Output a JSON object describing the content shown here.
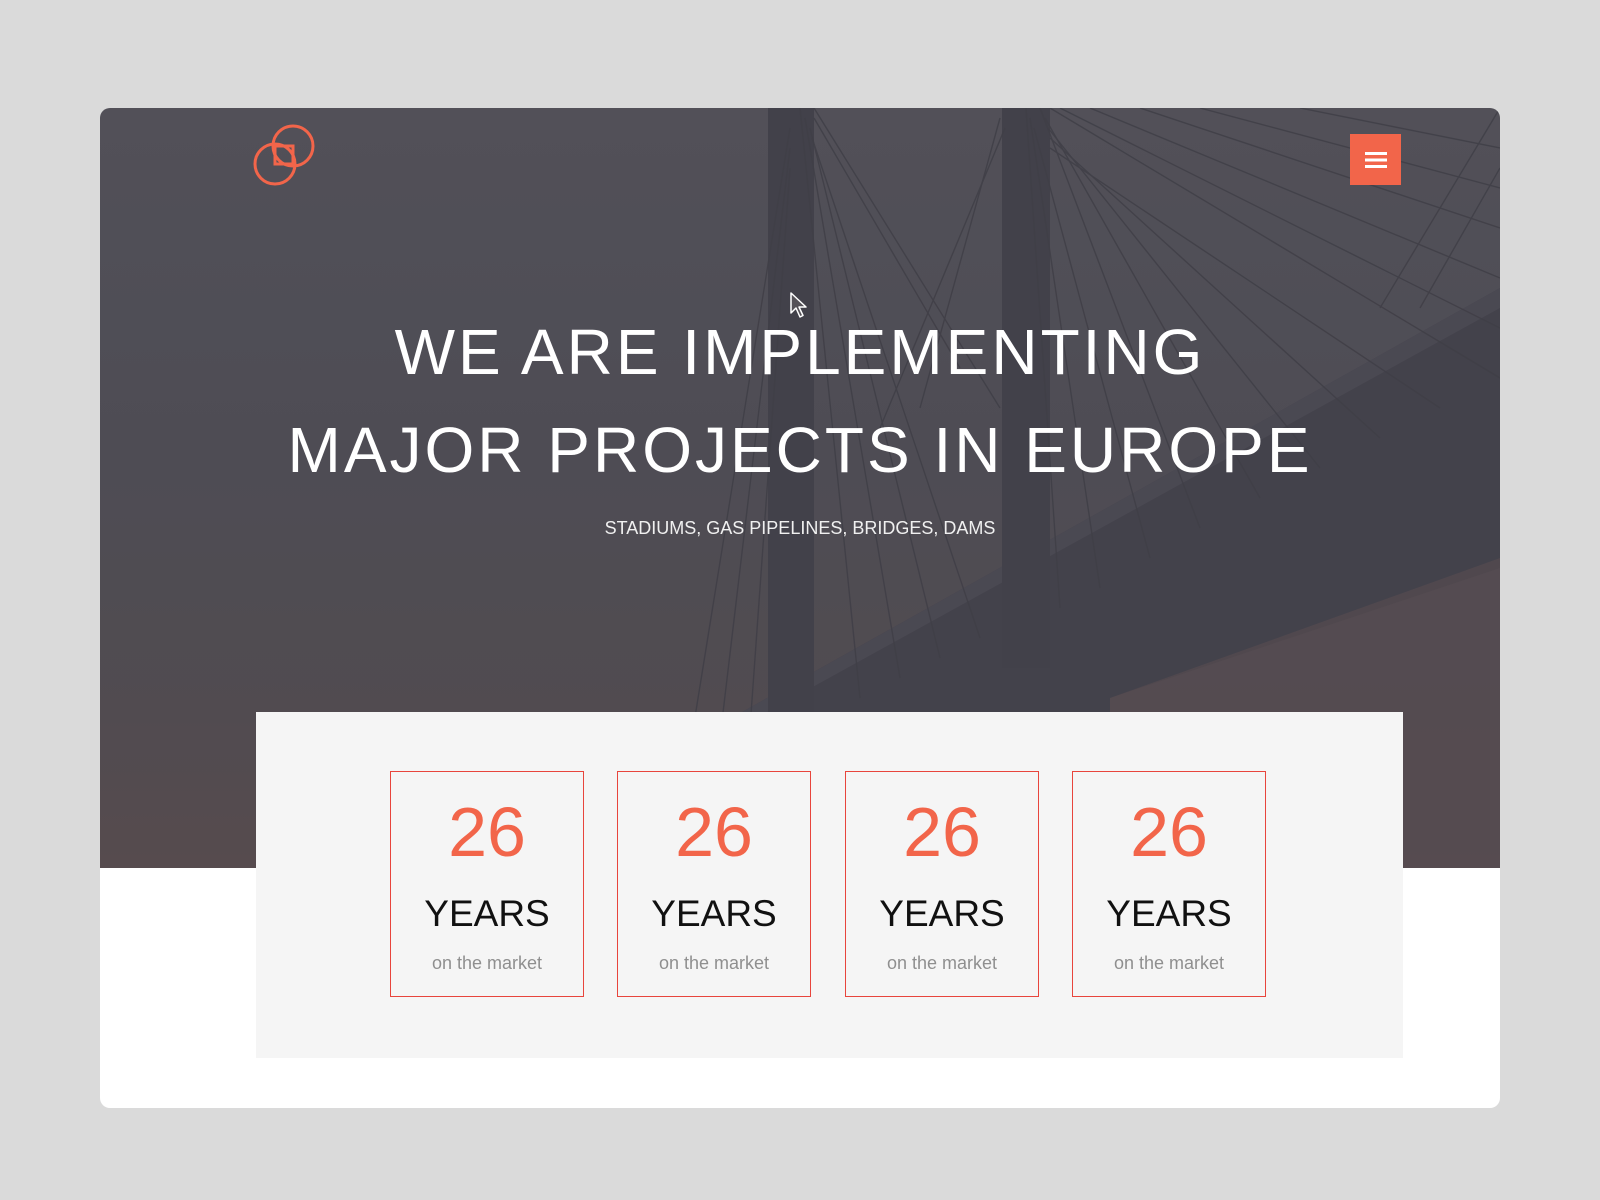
{
  "colors": {
    "accent": "#f2654a",
    "card_border": "#e8453c",
    "hero_overlay": "#4f4d55",
    "panel_bg": "#f5f5f5",
    "page_bg": "#dadada"
  },
  "header": {
    "logo_icon": "interlocking-rings-logo",
    "menu_icon": "hamburger-menu-icon"
  },
  "hero": {
    "headline_line1": "WE ARE IMPLEMENTING",
    "headline_line2": "MAJOR PROJECTS IN EUROPE",
    "subtitle": "STADIUMS, GAS PIPELINES, BRIDGES, DAMS"
  },
  "stats": [
    {
      "number": "26",
      "unit": "YEARS",
      "caption": "on the market"
    },
    {
      "number": "26",
      "unit": "YEARS",
      "caption": "on the market"
    },
    {
      "number": "26",
      "unit": "YEARS",
      "caption": "on the market"
    },
    {
      "number": "26",
      "unit": "YEARS",
      "caption": "on the market"
    }
  ]
}
